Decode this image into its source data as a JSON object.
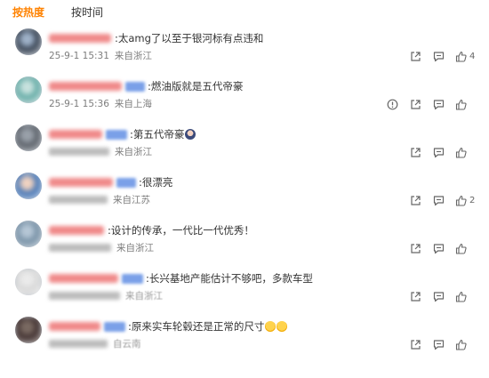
{
  "tabs": [
    {
      "label": "按热度",
      "active": true
    },
    {
      "label": "按时间",
      "active": false
    }
  ],
  "accent_color": "#ff8200",
  "comments": [
    {
      "avatar_colors": [
        "#2f3a4a",
        "#9fb2c9",
        "#e4e8ee"
      ],
      "name_color": "#f08a8a",
      "badge": false,
      "content": ":太amg了以至于银河标有点违和",
      "emoji": [],
      "date": "25-9-1 15:31",
      "location": "来自浙江",
      "report": false,
      "likes": "4"
    },
    {
      "avatar_colors": [
        "#5aa6a0",
        "#c8e2de",
        "#ffffff"
      ],
      "name_color": "#f08a8a",
      "badge": true,
      "content": ":燃油版就是五代帝豪",
      "emoji": [],
      "date": "25-9-1 15:36",
      "location": "来自上海",
      "report": true,
      "likes": ""
    },
    {
      "avatar_colors": [
        "#555b63",
        "#9aa1aa",
        "#d4d7db"
      ],
      "name_color": "#f08a8a",
      "badge": true,
      "content": ":第五代帝豪",
      "emoji": [
        "anime"
      ],
      "date": "",
      "location": "来自浙江",
      "report": false,
      "likes": ""
    },
    {
      "avatar_colors": [
        "#3c6fb2",
        "#f1d3c1",
        "#e7ecf4"
      ],
      "name_color": "#f08a8a",
      "badge": true,
      "content": ":很漂亮",
      "emoji": [],
      "date": "",
      "location": "来自江苏",
      "report": false,
      "likes": "2"
    },
    {
      "avatar_colors": [
        "#6f8aa0",
        "#b6c7d6",
        "#e9eef3"
      ],
      "name_color": "#f08a8a",
      "badge": false,
      "content": ":设计的传承，一代比一代优秀！",
      "emoji": [],
      "date": "",
      "location": "来自浙江",
      "report": false,
      "likes": ""
    },
    {
      "avatar_colors": [
        "#d6d6d6",
        "#ebebeb",
        "#f6f6f6"
      ],
      "name_color": "#f08a8a",
      "badge": true,
      "content": ":长兴基地产能估计不够吧，多款车型",
      "emoji": [],
      "date": "",
      "location": "来自浙江",
      "report": false,
      "likes": ""
    },
    {
      "avatar_colors": [
        "#3a2a2a",
        "#7a6a62",
        "#cfc4bd"
      ],
      "name_color": "#f08a8a",
      "badge": true,
      "content": ":原来实车轮毂还是正常的尺寸",
      "emoji": [
        "laugh",
        "laugh"
      ],
      "date": "",
      "location": "自云南",
      "report": false,
      "likes": ""
    }
  ],
  "icons": [
    "share-icon",
    "comment-icon",
    "like-icon",
    "report-icon"
  ]
}
